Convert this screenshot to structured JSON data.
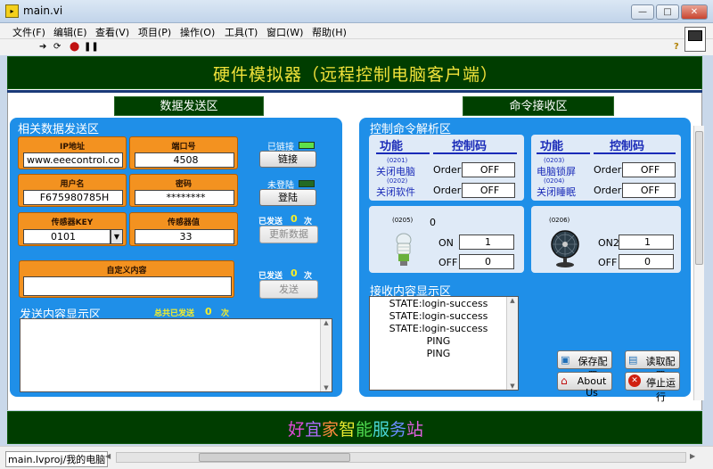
{
  "window": {
    "title": "main.vi"
  },
  "menu": [
    "文件(F)",
    "编辑(E)",
    "查看(V)",
    "项目(P)",
    "操作(O)",
    "工具(T)",
    "窗口(W)",
    "帮助(H)"
  ],
  "toolbar_icons": [
    "run-arrow-icon",
    "run-continuous-icon",
    "abort-icon",
    "pause-icon"
  ],
  "header_title": "硬件模拟器（远程控制电脑客户端）",
  "left_section": {
    "header": "数据发送区",
    "related_label": "相关数据发送区",
    "ip_label": "IP地址",
    "ip_value": "www.eeecontrol.co",
    "port_label": "端口号",
    "port_value": "4508",
    "user_label": "用户名",
    "user_value": "F675980785H",
    "pass_label": "密码",
    "pass_value": "********",
    "sensor_key_label": "传感器KEY",
    "sensor_key_value": "0101",
    "sensor_val_label": "传感器值",
    "sensor_val_value": "33",
    "linked_label": "已链接",
    "link_button": "链接",
    "not_logged_label": "未登陆",
    "login_button": "登陆",
    "sent_label_1": "已发送",
    "sent_count_1": "0",
    "sent_unit_1": "次",
    "update_button": "更新数据",
    "custom_label": "自定义内容",
    "custom_value": "",
    "sent_label_2": "已发送",
    "sent_count_2": "0",
    "sent_unit_2": "次",
    "send_button": "发送",
    "display_label": "发送内容显示区",
    "total_sent_label": "总共已发送",
    "total_sent_count": "0",
    "total_sent_unit": "次"
  },
  "right_section": {
    "header": "命令接收区",
    "parse_label": "控制命令解析区",
    "col_func": "功能",
    "col_code": "控制码",
    "left_cmds": [
      {
        "code": "(0201)",
        "name": "关闭电脑",
        "prefix": "Order",
        "value": "OFF"
      },
      {
        "code": "(0202)",
        "name": "关闭软件",
        "prefix": "Order",
        "value": "OFF"
      }
    ],
    "right_cmds": [
      {
        "code": "(0203)",
        "name": "电脑锁屏",
        "prefix": "Order",
        "value": "OFF"
      },
      {
        "code": "(0204)",
        "name": "关闭睡眠",
        "prefix": "Order",
        "value": "OFF"
      }
    ],
    "device1": {
      "code": "(0205)",
      "state": "0",
      "on_label": "ON",
      "on_value": "1",
      "off_label": "OFF",
      "off_value": "0"
    },
    "device2": {
      "code": "(0206)",
      "on_label": "ON2",
      "on_value": "1",
      "off_label": "OFF",
      "off_value": "0"
    },
    "receive_label": "接收内容显示区",
    "receive_lines": [
      "STATE:login-success",
      "STATE:login-success",
      "STATE:login-success",
      "PING",
      "PING"
    ],
    "save_button": "保存配置",
    "read_button": "读取配置",
    "about_button": "About Us",
    "stop_button": "停止运行"
  },
  "footer_chars": [
    "好",
    "宜",
    "家",
    "智",
    "能",
    "服",
    "务",
    "站"
  ],
  "footer_colors": [
    "#e04ad8",
    "#b36cff",
    "#ff8a3d",
    "#e8e830",
    "#4fd84f",
    "#4ad8d8",
    "#6a8dff",
    "#e060e0"
  ],
  "status": {
    "path": "main.lvproj/我的电脑"
  }
}
